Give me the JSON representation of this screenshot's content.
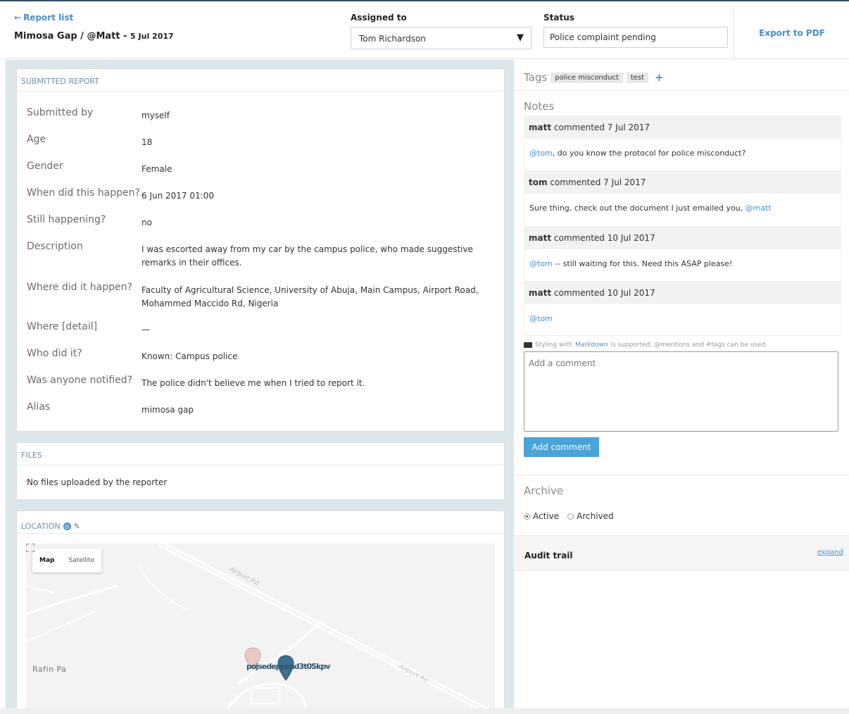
{
  "header": {
    "back_label": "Report list",
    "title": "Mimosa Gap / @Matt",
    "date": "5 Jul 2017",
    "assigned_label": "Assigned to",
    "assigned_value": "Tom Richardson",
    "status_label": "Status",
    "status_value": "Police complaint pending",
    "export_label": "Export to PDF"
  },
  "report": {
    "section_title": "SUBMITTED REPORT",
    "fields": [
      {
        "label": "Submitted by",
        "value": "myself"
      },
      {
        "label": "Age",
        "value": "18"
      },
      {
        "label": "Gender",
        "value": "Female"
      },
      {
        "label": "When did this happen?",
        "value": "6 Jun 2017 01:00"
      },
      {
        "label": "Still happening?",
        "value": "no"
      },
      {
        "label": "Description",
        "value": "I was escorted away from my car by the campus police, who made suggestive remarks in their offices."
      },
      {
        "label": "Where did it happen?",
        "value": "Faculty of Agricultural Science, University of Abuja, Main Campus, Airport Road, Mohammed Maccido Rd, Nigeria"
      },
      {
        "label": "Where [detail]",
        "value": "—"
      },
      {
        "label": "Who did it?",
        "value": "Known: Campus police"
      },
      {
        "label": "Was anyone notified?",
        "value": "The police didn't believe me when I tried to report it."
      },
      {
        "label": "Alias",
        "value": "mimosa gap"
      }
    ]
  },
  "files": {
    "section_title": "FILES",
    "empty_text": "No files uploaded by the reporter"
  },
  "location": {
    "section_title": "LOCATION",
    "map_tab": "Map",
    "satellite_tab": "Satellite",
    "place_label": "Rafin Pa",
    "road_label_1": "Airport Rd",
    "road_label_2": "Airport Rd",
    "marker_label": "pojsedeppsnd3t0Skpv"
  },
  "tags": {
    "title": "Tags",
    "items": [
      "police misconduct",
      "test"
    ]
  },
  "notes": {
    "title": "Notes",
    "items": [
      {
        "author": "matt",
        "meta": "commented 7 Jul 2017",
        "mention_before": "@tom",
        "text": ", do you know the protocol for police misconduct?",
        "mention_after": ""
      },
      {
        "author": "tom",
        "meta": "commented 7 Jul 2017",
        "mention_before": "",
        "text": "Sure thing, check out the document I just emailed you, ",
        "mention_after": "@matt"
      },
      {
        "author": "matt",
        "meta": "commented 10 Jul 2017",
        "mention_before": "@tom",
        "text": " -- still waiting for this. Need this ASAP please!",
        "mention_after": ""
      },
      {
        "author": "matt",
        "meta": "commented 10 Jul 2017",
        "mention_before": "@tom",
        "text": "",
        "mention_after": ""
      }
    ],
    "hint_prefix": "Styling with",
    "hint_link": "Markdown",
    "hint_suffix": "is supported; @mentions and #tags can be used",
    "comment_placeholder": "Add a comment",
    "add_comment_label": "Add comment"
  },
  "archive": {
    "title": "Archive",
    "active_label": "Active",
    "archived_label": "Archived",
    "selected": "Active"
  },
  "audit": {
    "title": "Audit trail",
    "expand_label": "expand"
  },
  "colors": {
    "accent": "#4a8fc8",
    "button": "#4aa3d9",
    "panel_bg": "#dde6ea",
    "marker_primary": "#3f6f8e",
    "marker_secondary": "#e8c9c4"
  }
}
